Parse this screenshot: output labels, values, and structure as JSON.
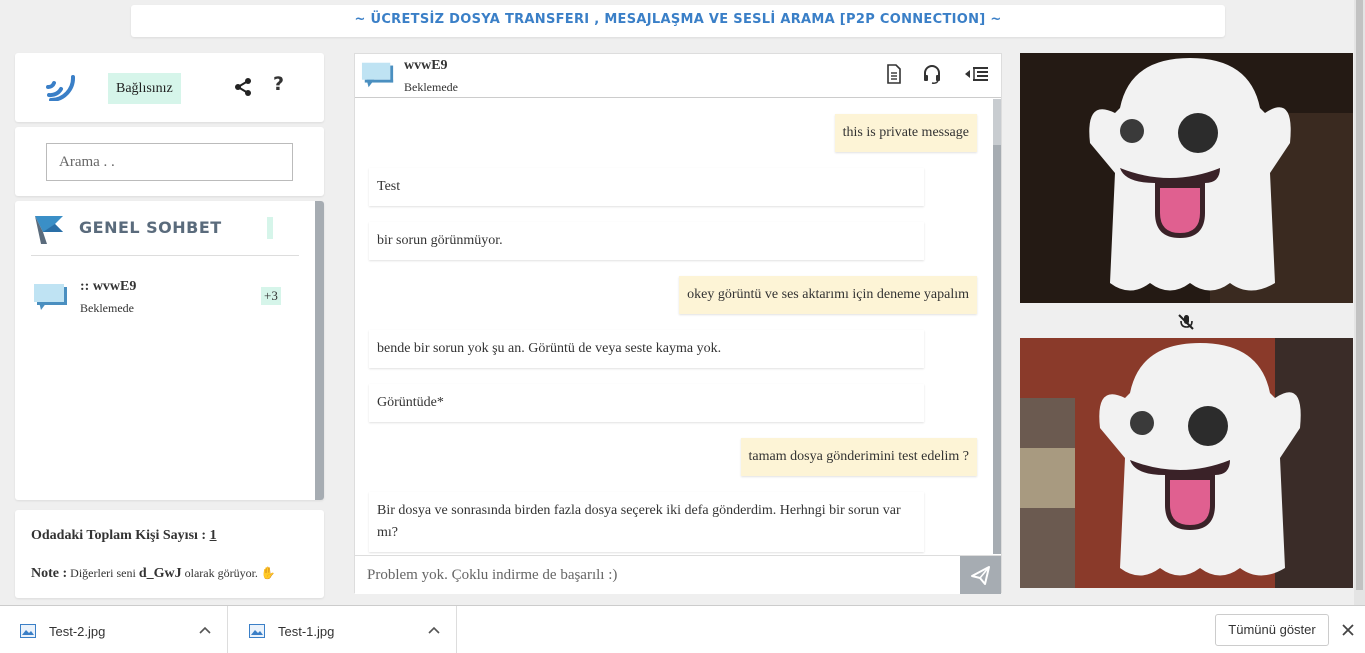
{
  "banner": {
    "title": "~ ÜCRETSİZ DOSYA TRANSFERI , MESAJLAŞMA VE SESLİ ARAMA [P2P CONNECTION] ~"
  },
  "top": {
    "status": "Bağlısınız",
    "help": "?"
  },
  "search": {
    "placeholder": "Arama . ."
  },
  "room": {
    "title": "GENEL SOHBET",
    "contact": {
      "name": ":: wvwE9",
      "status": "Beklemede",
      "count": "+3"
    }
  },
  "info": {
    "total_label": "Odadaki Toplam Kişi Sayısı :",
    "total_count": "1",
    "note_label": "Note :",
    "note_prefix": "Diğerleri seni",
    "note_user": "d_GwJ",
    "note_suffix": "olarak görüyor."
  },
  "chat": {
    "name": "wvwE9",
    "status": "Beklemede",
    "messages": [
      {
        "dir": "out",
        "text": "this is private message"
      },
      {
        "dir": "in",
        "text": "Test"
      },
      {
        "dir": "in",
        "text": "bir sorun görünmüyor."
      },
      {
        "dir": "out",
        "text": "okey görüntü ve ses aktarımı için deneme yapalım"
      },
      {
        "dir": "in",
        "text": "bende bir sorun yok şu an. Görüntü de veya seste kayma yok."
      },
      {
        "dir": "in",
        "text": "Görüntüde*"
      },
      {
        "dir": "out",
        "text": "tamam dosya gönderimini test edelim ?"
      },
      {
        "dir": "in",
        "text": "Bir dosya ve sonrasında birden fazla dosya seçerek iki defa gönderdim. Herhngi bir sorun var mı?"
      }
    ],
    "input_value": "",
    "input_placeholder": "Problem yok. Çoklu indirme de başarılı :)"
  },
  "downloads": {
    "items": [
      {
        "name": "Test-2.jpg"
      },
      {
        "name": "Test-1.jpg"
      }
    ],
    "show_all": "Tümünü göster"
  },
  "icons": {
    "logo": "signal-logo-icon",
    "share": "share-icon",
    "flag": "flag-icon",
    "chat": "chat-bubble-icon",
    "file": "document-icon",
    "headset": "headset-icon",
    "menu": "menu-collapse-icon",
    "send": "paper-plane-icon",
    "mute": "mute-mic-icon"
  },
  "colors": {
    "accent": "#3a7fc7",
    "badge": "#d6f5ea",
    "outgoing": "#fdf4d6",
    "scrollbar": "#a6acb2"
  }
}
